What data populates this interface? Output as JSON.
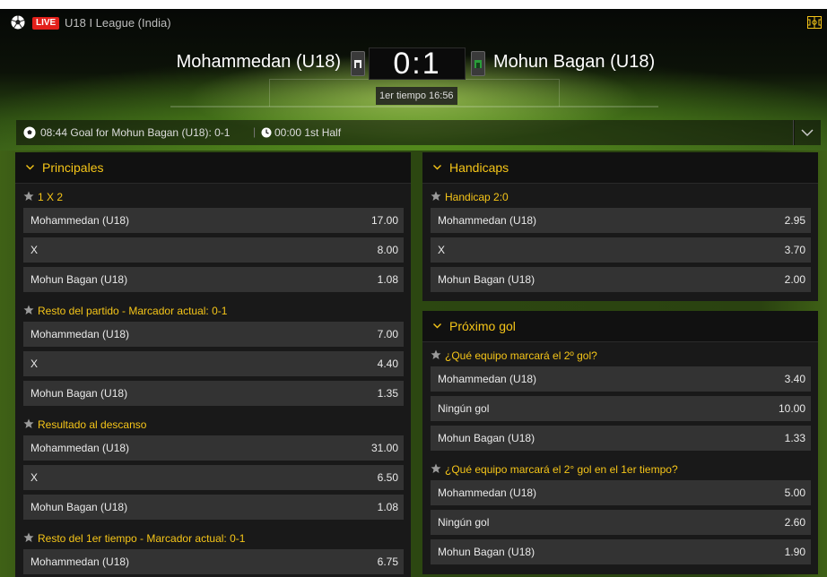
{
  "header": {
    "live_badge": "LIVE",
    "league": "U18 I League (India)",
    "home_team": "Mohammedan (U18)",
    "away_team": "Mohun Bagan (U18)",
    "score": "0:1",
    "match_time": "1er tiempo 16:56"
  },
  "ticker": {
    "event": "08:44 Goal for Mohun Bagan (U18): 0-1",
    "separator": "|",
    "half": "00:00 1st Half"
  },
  "colors": {
    "accent": "#f5c518",
    "live": "#e3201b",
    "row_bg": "#333333"
  },
  "panels": {
    "principales": {
      "title": "Principales",
      "markets": [
        {
          "title": "1 X 2",
          "rows": [
            {
              "label": "Mohammedan (U18)",
              "odd": "17.00"
            },
            {
              "label": "X",
              "odd": "8.00"
            },
            {
              "label": "Mohun Bagan (U18)",
              "odd": "1.08"
            }
          ]
        },
        {
          "title": "Resto del partido - Marcador actual: 0-1",
          "rows": [
            {
              "label": "Mohammedan (U18)",
              "odd": "7.00"
            },
            {
              "label": "X",
              "odd": "4.40"
            },
            {
              "label": "Mohun Bagan (U18)",
              "odd": "1.35"
            }
          ]
        },
        {
          "title": "Resultado al descanso",
          "rows": [
            {
              "label": "Mohammedan (U18)",
              "odd": "31.00"
            },
            {
              "label": "X",
              "odd": "6.50"
            },
            {
              "label": "Mohun Bagan (U18)",
              "odd": "1.08"
            }
          ]
        },
        {
          "title": "Resto del 1er tiempo - Marcador actual: 0-1",
          "rows": [
            {
              "label": "Mohammedan (U18)",
              "odd": "6.75"
            }
          ]
        }
      ]
    },
    "handicaps": {
      "title": "Handicaps",
      "markets": [
        {
          "title": "Handicap 2:0",
          "rows": [
            {
              "label": "Mohammedan (U18)",
              "odd": "2.95"
            },
            {
              "label": "X",
              "odd": "3.70"
            },
            {
              "label": "Mohun Bagan (U18)",
              "odd": "2.00"
            }
          ]
        }
      ]
    },
    "proximo_gol": {
      "title": "Próximo gol",
      "markets": [
        {
          "title": "¿Qué equipo marcará el 2º gol?",
          "rows": [
            {
              "label": "Mohammedan (U18)",
              "odd": "3.40"
            },
            {
              "label": "Ningún gol",
              "odd": "10.00"
            },
            {
              "label": "Mohun Bagan (U18)",
              "odd": "1.33"
            }
          ]
        },
        {
          "title": "¿Qué equipo marcará el 2° gol en el 1er tiempo?",
          "rows": [
            {
              "label": "Mohammedan (U18)",
              "odd": "5.00"
            },
            {
              "label": "Ningún gol",
              "odd": "2.60"
            },
            {
              "label": "Mohun Bagan (U18)",
              "odd": "1.90"
            }
          ]
        }
      ]
    }
  }
}
